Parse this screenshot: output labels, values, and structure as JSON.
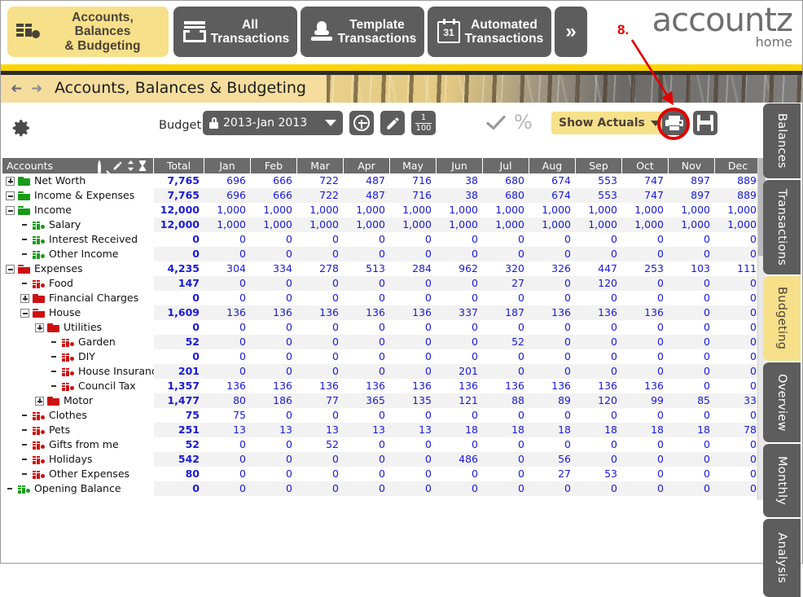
{
  "topnav": {
    "items": [
      {
        "label_line1": "Accounts, Balances",
        "label_line2": "& Budgeting",
        "icon": "coins-icon",
        "active": true
      },
      {
        "label_line1": "All",
        "label_line2": "Transactions",
        "icon": "archive-icon",
        "active": false
      },
      {
        "label_line1": "Template",
        "label_line2": "Transactions",
        "icon": "stamp-icon",
        "active": false
      },
      {
        "label_line1": "Automated",
        "label_line2": "Transactions",
        "icon": "calendar-icon",
        "calendar_day": "31",
        "active": false
      }
    ],
    "more_label": "»"
  },
  "logo": {
    "main": "accountz",
    "sub": "home"
  },
  "annotation": {
    "number": "8."
  },
  "titlebar": {
    "title": "Accounts, Balances & Budgeting",
    "back_icon": "back-arrow-icon",
    "forward_icon": "forward-arrow-icon"
  },
  "toolbar": {
    "gear_icon": "gear-icon",
    "budget_label": "Budget:",
    "budget_value": "2013-Jan 2013",
    "budget_locked_icon": "lock-icon",
    "add_icon": "plus-circle-icon",
    "edit_icon": "pencil-icon",
    "fraction_numerator": "1",
    "fraction_denominator": "100",
    "cancel_icon": "cancel-circle-icon",
    "confirm_icon": "check-icon",
    "percent_icon": "percent-icon",
    "show_actuals_label": "Show Actuals",
    "print_icon": "print-icon",
    "save_icon": "save-disk-icon"
  },
  "sidetabs": [
    {
      "label": "Balances",
      "active": false
    },
    {
      "label": "Transactions",
      "active": false
    },
    {
      "label": "Budgeting",
      "active": true
    },
    {
      "label": "Overview",
      "active": false
    },
    {
      "label": "Monthly",
      "active": false
    },
    {
      "label": "Analysis",
      "active": false
    }
  ],
  "table": {
    "accounts_header": "Accounts",
    "header_icons": [
      "search-icon",
      "pencil-icon",
      "sort-updown-icon",
      "hourglass-icon"
    ],
    "columns": [
      "Total",
      "Jan",
      "Feb",
      "Mar",
      "Apr",
      "May",
      "Jun",
      "Jul",
      "Aug",
      "Sep",
      "Oct",
      "Nov",
      "Dec"
    ],
    "rows": [
      {
        "name": "Net Worth",
        "indent": 0,
        "expander": "plus",
        "icon": "folder-green",
        "values": [
          "7,765",
          "696",
          "666",
          "722",
          "487",
          "716",
          "38",
          "680",
          "674",
          "553",
          "747",
          "897",
          "889"
        ]
      },
      {
        "name": "Income & Expenses",
        "indent": 0,
        "expander": "minus",
        "icon": "folder-green-open",
        "values": [
          "7,765",
          "696",
          "666",
          "722",
          "487",
          "716",
          "38",
          "680",
          "674",
          "553",
          "747",
          "897",
          "889"
        ]
      },
      {
        "name": "Income",
        "indent": 1,
        "expander": "minus",
        "icon": "folder-green-open",
        "values": [
          "12,000",
          "1,000",
          "1,000",
          "1,000",
          "1,000",
          "1,000",
          "1,000",
          "1,000",
          "1,000",
          "1,000",
          "1,000",
          "1,000",
          "1,000"
        ]
      },
      {
        "name": "Salary",
        "indent": 2,
        "expander": "none",
        "icon": "bars-green",
        "values": [
          "12,000",
          "1,000",
          "1,000",
          "1,000",
          "1,000",
          "1,000",
          "1,000",
          "1,000",
          "1,000",
          "1,000",
          "1,000",
          "1,000",
          "1,000"
        ]
      },
      {
        "name": "Interest Received",
        "indent": 2,
        "expander": "none",
        "icon": "bars-green",
        "values": [
          "0",
          "0",
          "0",
          "0",
          "0",
          "0",
          "0",
          "0",
          "0",
          "0",
          "0",
          "0",
          "0"
        ]
      },
      {
        "name": "Other Income",
        "indent": 2,
        "expander": "none",
        "icon": "bars-green",
        "values": [
          "0",
          "0",
          "0",
          "0",
          "0",
          "0",
          "0",
          "0",
          "0",
          "0",
          "0",
          "0",
          "0"
        ]
      },
      {
        "name": "Expenses",
        "indent": 1,
        "expander": "minus",
        "icon": "folder-red-open",
        "values": [
          "4,235",
          "304",
          "334",
          "278",
          "513",
          "284",
          "962",
          "320",
          "326",
          "447",
          "253",
          "103",
          "111"
        ]
      },
      {
        "name": "Food",
        "indent": 2,
        "expander": "none",
        "icon": "bars-red",
        "values": [
          "147",
          "0",
          "0",
          "0",
          "0",
          "0",
          "0",
          "27",
          "0",
          "120",
          "0",
          "0",
          "0"
        ]
      },
      {
        "name": "Financial Charges",
        "indent": 2,
        "expander": "plus",
        "icon": "folder-red",
        "values": [
          "0",
          "0",
          "0",
          "0",
          "0",
          "0",
          "0",
          "0",
          "0",
          "0",
          "0",
          "0",
          "0"
        ]
      },
      {
        "name": "House",
        "indent": 2,
        "expander": "minus",
        "icon": "folder-red-open",
        "values": [
          "1,609",
          "136",
          "136",
          "136",
          "136",
          "136",
          "337",
          "187",
          "136",
          "136",
          "136",
          "0",
          "0"
        ]
      },
      {
        "name": "Utilities",
        "indent": 3,
        "expander": "plus",
        "icon": "folder-red",
        "values": [
          "0",
          "0",
          "0",
          "0",
          "0",
          "0",
          "0",
          "0",
          "0",
          "0",
          "0",
          "0",
          "0"
        ]
      },
      {
        "name": "Garden",
        "indent": 4,
        "expander": "none",
        "icon": "bars-red",
        "values": [
          "52",
          "0",
          "0",
          "0",
          "0",
          "0",
          "0",
          "52",
          "0",
          "0",
          "0",
          "0",
          "0"
        ]
      },
      {
        "name": "DIY",
        "indent": 4,
        "expander": "none",
        "icon": "bars-red",
        "values": [
          "0",
          "0",
          "0",
          "0",
          "0",
          "0",
          "0",
          "0",
          "0",
          "0",
          "0",
          "0",
          "0"
        ]
      },
      {
        "name": "House Insuranc",
        "indent": 4,
        "expander": "none",
        "icon": "bars-red",
        "values": [
          "201",
          "0",
          "0",
          "0",
          "0",
          "0",
          "201",
          "0",
          "0",
          "0",
          "0",
          "0",
          "0"
        ]
      },
      {
        "name": "Council Tax",
        "indent": 4,
        "expander": "none",
        "icon": "bars-red",
        "values": [
          "1,357",
          "136",
          "136",
          "136",
          "136",
          "136",
          "136",
          "136",
          "136",
          "136",
          "136",
          "0",
          "0"
        ]
      },
      {
        "name": "Motor",
        "indent": 3,
        "expander": "plus",
        "icon": "folder-red",
        "values": [
          "1,477",
          "80",
          "186",
          "77",
          "365",
          "135",
          "121",
          "88",
          "89",
          "120",
          "99",
          "85",
          "33"
        ]
      },
      {
        "name": "Clothes",
        "indent": 2,
        "expander": "none",
        "icon": "bars-red",
        "values": [
          "75",
          "75",
          "0",
          "0",
          "0",
          "0",
          "0",
          "0",
          "0",
          "0",
          "0",
          "0",
          "0"
        ]
      },
      {
        "name": "Pets",
        "indent": 2,
        "expander": "none",
        "icon": "bars-red",
        "values": [
          "251",
          "13",
          "13",
          "13",
          "13",
          "13",
          "18",
          "18",
          "18",
          "18",
          "18",
          "18",
          "78"
        ]
      },
      {
        "name": "Gifts from me",
        "indent": 2,
        "expander": "none",
        "icon": "bars-red",
        "values": [
          "52",
          "0",
          "0",
          "52",
          "0",
          "0",
          "0",
          "0",
          "0",
          "0",
          "0",
          "0",
          "0"
        ]
      },
      {
        "name": "Holidays",
        "indent": 2,
        "expander": "none",
        "icon": "bars-red",
        "values": [
          "542",
          "0",
          "0",
          "0",
          "0",
          "0",
          "486",
          "0",
          "56",
          "0",
          "0",
          "0",
          "0"
        ]
      },
      {
        "name": "Other Expenses",
        "indent": 2,
        "expander": "none",
        "icon": "bars-red",
        "values": [
          "80",
          "0",
          "0",
          "0",
          "0",
          "0",
          "0",
          "0",
          "27",
          "53",
          "0",
          "0",
          "0"
        ]
      },
      {
        "name": "Opening Balance",
        "indent": 0,
        "expander": "none",
        "icon": "bars-green",
        "values": [
          "0",
          "0",
          "0",
          "0",
          "0",
          "0",
          "0",
          "0",
          "0",
          "0",
          "0",
          "0",
          "0"
        ]
      }
    ]
  },
  "colors": {
    "accent": "#f7e08a",
    "brand_yellow": "#ffd400",
    "dark": "#5d5d5d",
    "value_blue": "#1a1ad6",
    "annotation_red": "#e00000"
  }
}
